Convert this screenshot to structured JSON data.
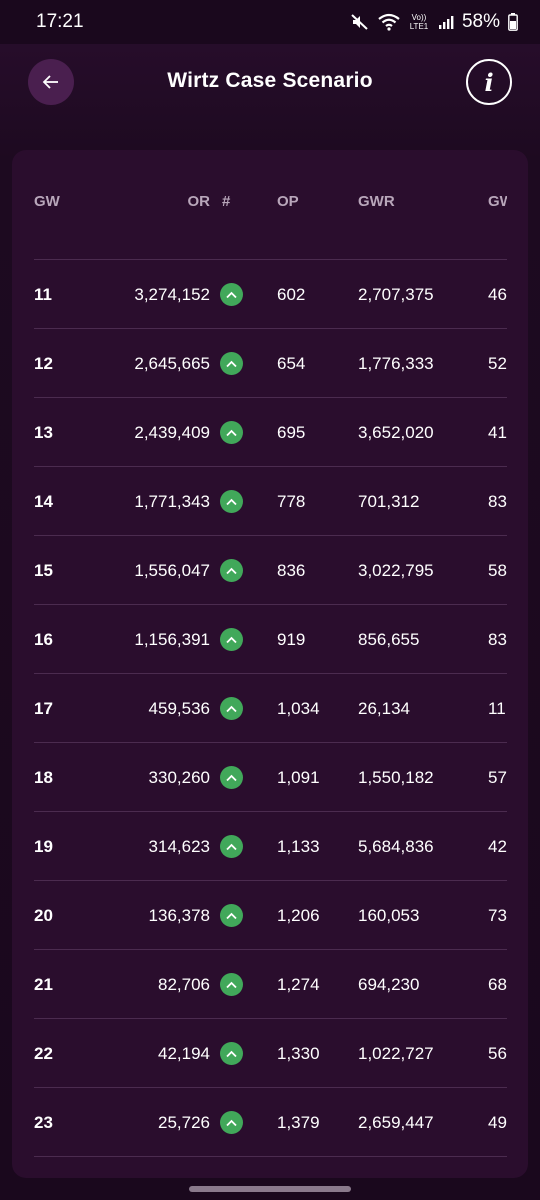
{
  "status_bar": {
    "time": "17:21",
    "battery": "58%",
    "network": "Vo)) LTE1"
  },
  "header": {
    "title": "Wirtz Case Scenario",
    "info_label": "i"
  },
  "table": {
    "columns": [
      "GW",
      "OR",
      "#",
      "OP",
      "GWR",
      "GW"
    ],
    "rows": [
      {
        "gw": "11",
        "or": "3,274,152",
        "op": "602",
        "gwr": "2,707,375",
        "gw2": "46"
      },
      {
        "gw": "12",
        "or": "2,645,665",
        "op": "654",
        "gwr": "1,776,333",
        "gw2": "52"
      },
      {
        "gw": "13",
        "or": "2,439,409",
        "op": "695",
        "gwr": "3,652,020",
        "gw2": "41"
      },
      {
        "gw": "14",
        "or": "1,771,343",
        "op": "778",
        "gwr": "701,312",
        "gw2": "83"
      },
      {
        "gw": "15",
        "or": "1,556,047",
        "op": "836",
        "gwr": "3,022,795",
        "gw2": "58"
      },
      {
        "gw": "16",
        "or": "1,156,391",
        "op": "919",
        "gwr": "856,655",
        "gw2": "83"
      },
      {
        "gw": "17",
        "or": "459,536",
        "op": "1,034",
        "gwr": "26,134",
        "gw2": "11"
      },
      {
        "gw": "18",
        "or": "330,260",
        "op": "1,091",
        "gwr": "1,550,182",
        "gw2": "57"
      },
      {
        "gw": "19",
        "or": "314,623",
        "op": "1,133",
        "gwr": "5,684,836",
        "gw2": "42"
      },
      {
        "gw": "20",
        "or": "136,378",
        "op": "1,206",
        "gwr": "160,053",
        "gw2": "73"
      },
      {
        "gw": "21",
        "or": "82,706",
        "op": "1,274",
        "gwr": "694,230",
        "gw2": "68"
      },
      {
        "gw": "22",
        "or": "42,194",
        "op": "1,330",
        "gwr": "1,022,727",
        "gw2": "56"
      },
      {
        "gw": "23",
        "or": "25,726",
        "op": "1,379",
        "gwr": "2,659,447",
        "gw2": "49"
      }
    ]
  },
  "icons": {
    "rank_change": "arrow-up-circle-icon",
    "back": "arrow-left-icon",
    "info": "info-icon",
    "mute": "mute-icon",
    "wifi": "wifi-icon",
    "signal": "signal-icon",
    "battery": "battery-icon"
  },
  "colors": {
    "background": "#1f0a22",
    "card": "#2a0d2d",
    "accent_green": "#41a85a",
    "back_button": "#4a1f4f"
  }
}
